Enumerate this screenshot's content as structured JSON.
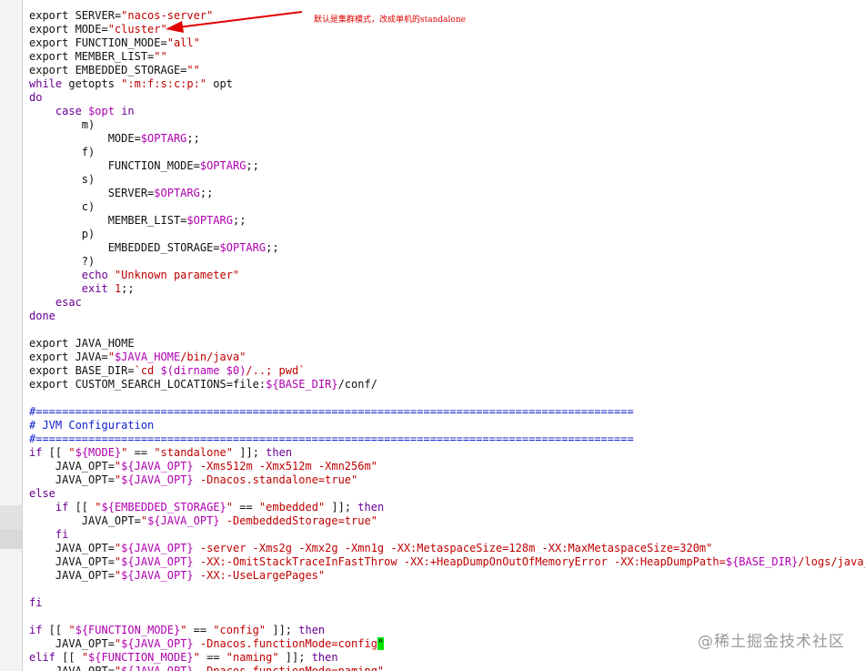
{
  "colors": {
    "plain": "#101010",
    "keyword": "#6a0092",
    "string": "#c00000",
    "variable": "#b000b0",
    "comment": "#1020d0",
    "cursor_bg": "#00e400",
    "annotation": "#e00000"
  },
  "annotation": {
    "text": "默认是集群模式，改成单机的standalone",
    "icon": "red-arrow-icon"
  },
  "watermark": "@稀土掘金技术社区",
  "code_lines": [
    [
      [
        "plain",
        "export SERVER="
      ],
      [
        "string",
        "\"nacos-server\""
      ]
    ],
    [
      [
        "plain",
        "export MODE="
      ],
      [
        "string",
        "\"cluster\""
      ]
    ],
    [
      [
        "plain",
        "export FUNCTION_MODE="
      ],
      [
        "string",
        "\"all\""
      ]
    ],
    [
      [
        "plain",
        "export MEMBER_LIST="
      ],
      [
        "string",
        "\"\""
      ]
    ],
    [
      [
        "plain",
        "export EMBEDDED_STORAGE="
      ],
      [
        "string",
        "\"\""
      ]
    ],
    [
      [
        "keyword",
        "while"
      ],
      [
        "plain",
        " getopts "
      ],
      [
        "string",
        "\":m:f:s:c:p:\""
      ],
      [
        "plain",
        " opt"
      ]
    ],
    [
      [
        "keyword",
        "do"
      ]
    ],
    [
      [
        "plain",
        "    "
      ],
      [
        "keyword",
        "case"
      ],
      [
        "plain",
        " "
      ],
      [
        "var",
        "$opt"
      ],
      [
        "plain",
        " "
      ],
      [
        "keyword",
        "in"
      ]
    ],
    [
      [
        "plain",
        "        m)"
      ]
    ],
    [
      [
        "plain",
        "            MODE="
      ],
      [
        "var",
        "$OPTARG"
      ],
      [
        "plain",
        ";;"
      ]
    ],
    [
      [
        "plain",
        "        f)"
      ]
    ],
    [
      [
        "plain",
        "            FUNCTION_MODE="
      ],
      [
        "var",
        "$OPTARG"
      ],
      [
        "plain",
        ";;"
      ]
    ],
    [
      [
        "plain",
        "        s)"
      ]
    ],
    [
      [
        "plain",
        "            SERVER="
      ],
      [
        "var",
        "$OPTARG"
      ],
      [
        "plain",
        ";;"
      ]
    ],
    [
      [
        "plain",
        "        c)"
      ]
    ],
    [
      [
        "plain",
        "            MEMBER_LIST="
      ],
      [
        "var",
        "$OPTARG"
      ],
      [
        "plain",
        ";;"
      ]
    ],
    [
      [
        "plain",
        "        p)"
      ]
    ],
    [
      [
        "plain",
        "            EMBEDDED_STORAGE="
      ],
      [
        "var",
        "$OPTARG"
      ],
      [
        "plain",
        ";;"
      ]
    ],
    [
      [
        "plain",
        "        ?)"
      ]
    ],
    [
      [
        "plain",
        "        "
      ],
      [
        "keyword",
        "echo"
      ],
      [
        "plain",
        " "
      ],
      [
        "string",
        "\"Unknown parameter\""
      ]
    ],
    [
      [
        "plain",
        "        "
      ],
      [
        "keyword",
        "exit"
      ],
      [
        "plain",
        " "
      ],
      [
        "string",
        "1"
      ],
      [
        "plain",
        ";;"
      ]
    ],
    [
      [
        "plain",
        "    "
      ],
      [
        "keyword",
        "esac"
      ]
    ],
    [
      [
        "keyword",
        "done"
      ]
    ],
    [],
    [
      [
        "plain",
        "export JAVA_HOME"
      ]
    ],
    [
      [
        "plain",
        "export JAVA="
      ],
      [
        "string",
        "\""
      ],
      [
        "var",
        "$JAVA_HOME"
      ],
      [
        "string",
        "/bin/java\""
      ]
    ],
    [
      [
        "plain",
        "export BASE_DIR="
      ],
      [
        "string",
        "`cd "
      ],
      [
        "var",
        "$(dirname $0)"
      ],
      [
        "string",
        "/..; pwd`"
      ]
    ],
    [
      [
        "plain",
        "export CUSTOM_SEARCH_LOCATIONS=file:"
      ],
      [
        "var",
        "${BASE_DIR}"
      ],
      [
        "plain",
        "/conf/"
      ]
    ],
    [],
    [
      [
        "comment",
        "#==========================================================================================="
      ]
    ],
    [
      [
        "comment",
        "# JVM Configuration"
      ]
    ],
    [
      [
        "comment",
        "#==========================================================================================="
      ]
    ],
    [
      [
        "keyword",
        "if"
      ],
      [
        "plain",
        " [[ "
      ],
      [
        "string",
        "\""
      ],
      [
        "var",
        "${MODE}"
      ],
      [
        "string",
        "\""
      ],
      [
        "plain",
        " == "
      ],
      [
        "string",
        "\"standalone\""
      ],
      [
        "plain",
        " ]]; "
      ],
      [
        "keyword",
        "then"
      ]
    ],
    [
      [
        "plain",
        "    JAVA_OPT="
      ],
      [
        "string",
        "\""
      ],
      [
        "var",
        "${JAVA_OPT}"
      ],
      [
        "string",
        " -Xms512m -Xmx512m -Xmn256m\""
      ]
    ],
    [
      [
        "plain",
        "    JAVA_OPT="
      ],
      [
        "string",
        "\""
      ],
      [
        "var",
        "${JAVA_OPT}"
      ],
      [
        "string",
        " -Dnacos.standalone=true\""
      ]
    ],
    [
      [
        "keyword",
        "else"
      ]
    ],
    [
      [
        "plain",
        "    "
      ],
      [
        "keyword",
        "if"
      ],
      [
        "plain",
        " [[ "
      ],
      [
        "string",
        "\""
      ],
      [
        "var",
        "${EMBEDDED_STORAGE}"
      ],
      [
        "string",
        "\""
      ],
      [
        "plain",
        " == "
      ],
      [
        "string",
        "\"embedded\""
      ],
      [
        "plain",
        " ]]; "
      ],
      [
        "keyword",
        "then"
      ]
    ],
    [
      [
        "plain",
        "        JAVA_OPT="
      ],
      [
        "string",
        "\""
      ],
      [
        "var",
        "${JAVA_OPT}"
      ],
      [
        "string",
        " -DembeddedStorage=true\""
      ]
    ],
    [
      [
        "plain",
        "    "
      ],
      [
        "keyword",
        "fi"
      ]
    ],
    [
      [
        "plain",
        "    JAVA_OPT="
      ],
      [
        "string",
        "\""
      ],
      [
        "var",
        "${JAVA_OPT}"
      ],
      [
        "string",
        " -server -Xms2g -Xmx2g -Xmn1g -XX:MetaspaceSize=128m -XX:MaxMetaspaceSize=320m\""
      ]
    ],
    [
      [
        "plain",
        "    JAVA_OPT="
      ],
      [
        "string",
        "\""
      ],
      [
        "var",
        "${JAVA_OPT}"
      ],
      [
        "string",
        " -XX:-OmitStackTraceInFastThrow -XX:+HeapDumpOnOutOfMemoryError -XX:HeapDumpPath="
      ],
      [
        "var",
        "${BASE_DIR}"
      ],
      [
        "string",
        "/logs/java_heapdump.hprof\""
      ]
    ],
    [
      [
        "plain",
        "    JAVA_OPT="
      ],
      [
        "string",
        "\""
      ],
      [
        "var",
        "${JAVA_OPT}"
      ],
      [
        "string",
        " -XX:-UseLargePages\""
      ]
    ],
    [],
    [
      [
        "keyword",
        "fi"
      ]
    ],
    [],
    [
      [
        "keyword",
        "if"
      ],
      [
        "plain",
        " [[ "
      ],
      [
        "string",
        "\""
      ],
      [
        "var",
        "${FUNCTION_MODE}"
      ],
      [
        "string",
        "\""
      ],
      [
        "plain",
        " == "
      ],
      [
        "string",
        "\"config\""
      ],
      [
        "plain",
        " ]]; "
      ],
      [
        "keyword",
        "then"
      ]
    ],
    [
      [
        "plain",
        "    JAVA_OPT="
      ],
      [
        "string",
        "\""
      ],
      [
        "var",
        "${JAVA_OPT}"
      ],
      [
        "string",
        " -Dnacos.functionMode=config"
      ],
      [
        "cursor",
        "\""
      ]
    ],
    [
      [
        "keyword",
        "elif"
      ],
      [
        "plain",
        " [[ "
      ],
      [
        "string",
        "\""
      ],
      [
        "var",
        "${FUNCTION_MODE}"
      ],
      [
        "string",
        "\""
      ],
      [
        "plain",
        " == "
      ],
      [
        "string",
        "\"naming\""
      ],
      [
        "plain",
        " ]]; "
      ],
      [
        "keyword",
        "then"
      ]
    ],
    [
      [
        "plain",
        "    JAVA_OPT="
      ],
      [
        "string",
        "\""
      ],
      [
        "var",
        "${JAVA_OPT}"
      ],
      [
        "string",
        " -Dnacos.functionMode=naming\""
      ]
    ]
  ]
}
